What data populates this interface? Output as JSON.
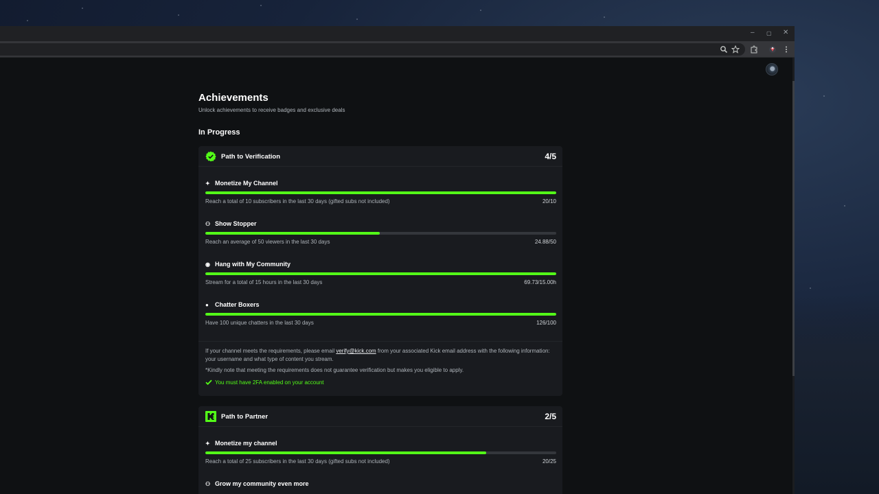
{
  "browser": {
    "window_controls": [
      "–",
      "▢",
      "✕"
    ],
    "toolbar_icons": [
      "zoom-icon",
      "bookmark-star-icon",
      "extensions-icon",
      "profile-icon",
      "menu-icon"
    ]
  },
  "page": {
    "title": "Achievements",
    "subtitle": "Unlock achievements to receive badges and exclusive deals",
    "section_title": "In Progress"
  },
  "colors": {
    "accent": "#53fc18",
    "card_bg": "#191b1f",
    "page_bg": "#0f1113"
  },
  "verification": {
    "title": "Path to Verification",
    "count": "4/5",
    "tasks": [
      {
        "title": "Monetize My Channel",
        "icon": "sparkle-icon",
        "desc": "Reach a total of 10 subscribers in the last 30 days (gifted subs not included)",
        "value": "20/10",
        "progress": 1.0
      },
      {
        "title": "Show Stopper",
        "icon": "users-icon",
        "desc": "Reach an average of 50 viewers in the last 30 days",
        "value": "24.88/50",
        "progress": 0.4976
      },
      {
        "title": "Hang with My Community",
        "icon": "broadcast-icon",
        "desc": "Stream for a total of 15 hours in the last 30 days",
        "value": "69.73/15.00h",
        "progress": 1.0
      },
      {
        "title": "Chatter Boxers",
        "icon": "chat-icon",
        "desc": "Have 100 unique chatters in the last 30 days",
        "value": "126/100",
        "progress": 1.0
      }
    ],
    "note_prefix": "If your channel meets the requirements, please email ",
    "note_email": "verify@kick.com",
    "note_suffix": " from your associated Kick email address with the following information: your username and what type of content you stream.",
    "disclaimer": "*Kindly note that meeting the requirements does not guarantee verification but makes you eligible to apply.",
    "requirement": "You must have 2FA enabled on your account"
  },
  "partner": {
    "title": "Path to Partner",
    "count": "2/5",
    "tasks": [
      {
        "title": "Monetize my channel",
        "icon": "sparkle-icon",
        "desc": "Reach a total of 25 subscribers in the last 30 days (gifted subs not included)",
        "value": "20/25",
        "progress": 0.8
      },
      {
        "title": "Grow my community even more",
        "icon": "users-icon"
      }
    ]
  }
}
